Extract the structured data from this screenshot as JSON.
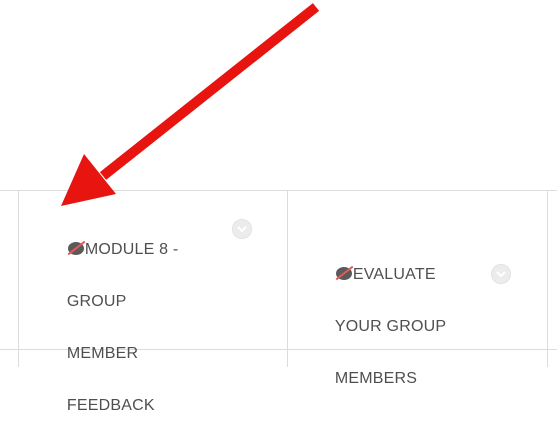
{
  "columns": [
    {
      "title": "MODULE 8 - GROUP MEMBER FEEDBACK",
      "title_lines": [
        "MODULE 8 -",
        "GROUP",
        "MEMBER",
        "FEEDBACK"
      ],
      "hidden_icon": "eye-slash-icon",
      "menu_icon": "chevron-down-icon"
    },
    {
      "title": "EVALUATE YOUR GROUP MEMBERS",
      "title_lines": [
        "EVALUATE",
        "YOUR GROUP",
        "MEMBERS"
      ],
      "hidden_icon": "eye-slash-icon",
      "menu_icon": "chevron-down-icon"
    }
  ],
  "annotation": {
    "type": "arrow",
    "color": "#e8140f"
  },
  "colors": {
    "gridline": "#dcdcdc",
    "text": "#4f4f4f",
    "hidden_icon": "#5a5a5a",
    "hidden_slash": "#e05a5a"
  }
}
